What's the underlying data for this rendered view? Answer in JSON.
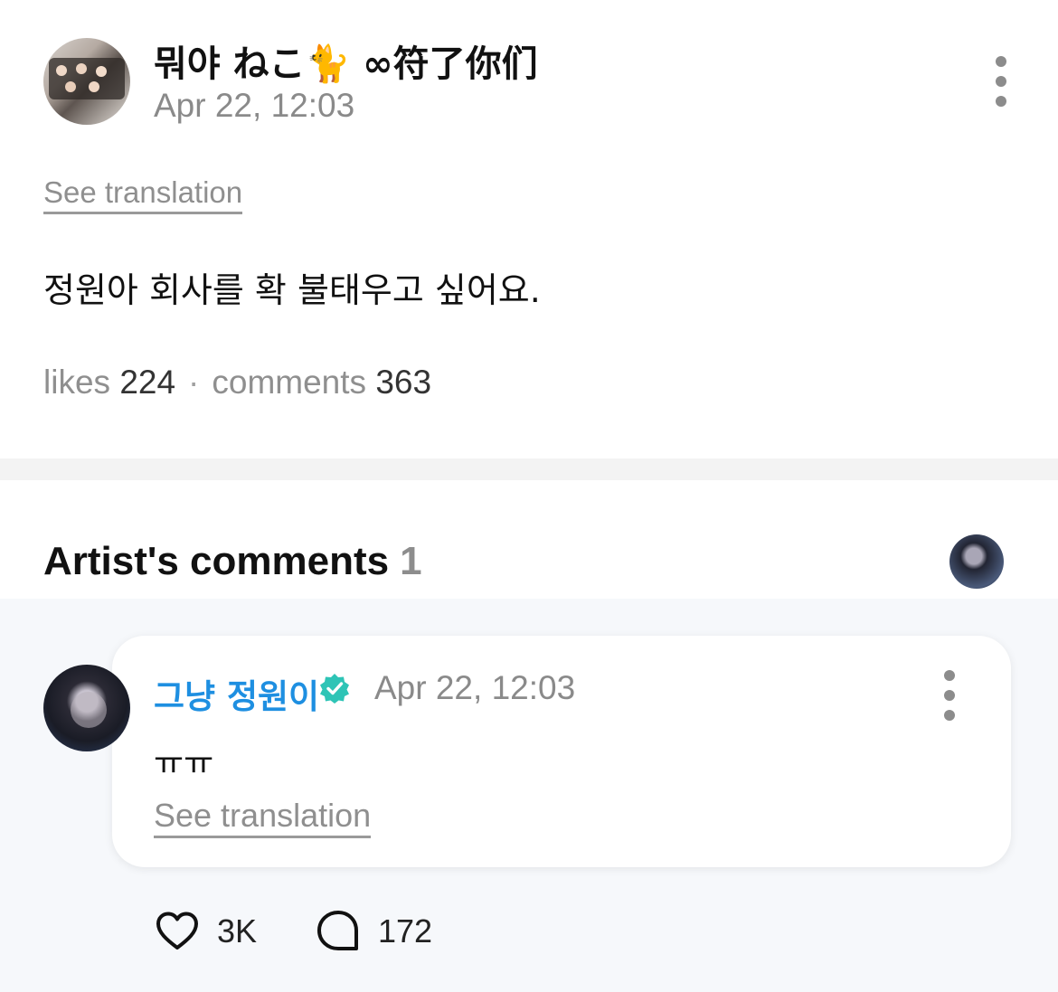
{
  "post": {
    "author_name": "뭐야 ねこ🐈 ∞符了你们",
    "date": "Apr 22, 12:03",
    "see_translation": "See translation",
    "body": "정원아 회사를 확 불태우고 싶어요.",
    "likes_label": "likes",
    "likes_count": "224",
    "separator": "·",
    "comments_label": "comments",
    "comments_count": "363"
  },
  "artist_comments": {
    "title": "Artist's comments",
    "count": "1"
  },
  "comment": {
    "author_name": "그냥 정원이",
    "verified_color": "#2ec4b6",
    "date": "Apr 22, 12:03",
    "text": "ㅠㅠ",
    "see_translation": "See translation",
    "likes": "3K",
    "replies": "172"
  },
  "icons": {
    "more": "kebab-menu-icon",
    "verified": "verified-badge-icon",
    "like": "heart-icon",
    "reply": "speech-bubble-icon"
  }
}
